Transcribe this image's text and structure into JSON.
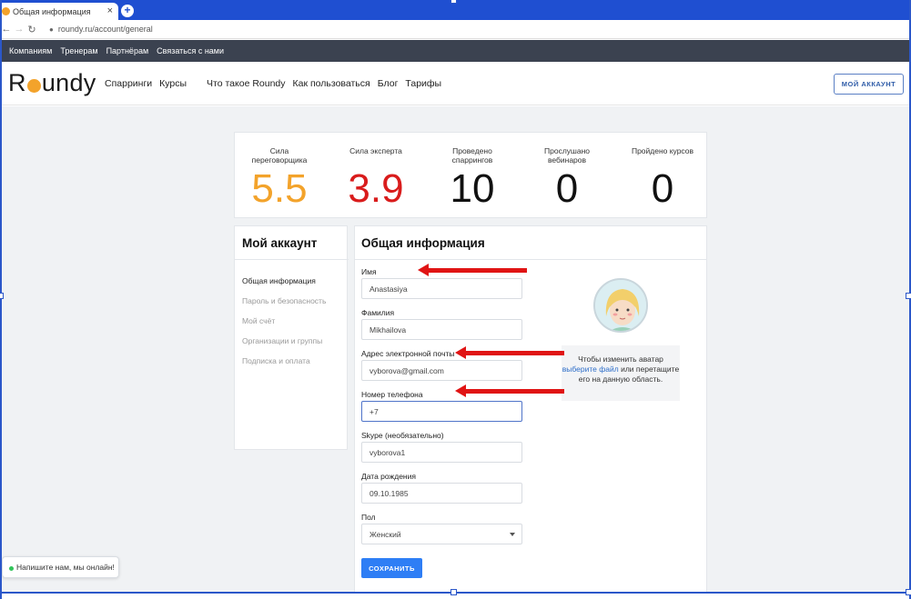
{
  "browser": {
    "tab_title": "Общая информация",
    "tab_close": "×",
    "new_tab": "+",
    "url": "roundy.ru/account/general",
    "back_icon": "arrow-left-icon",
    "forward_icon": "arrow-right-icon",
    "reload_icon": "reload-icon"
  },
  "topstrip": {
    "links": [
      "Компаниям",
      "Тренерам",
      "Партнёрам",
      "Связаться с нами"
    ]
  },
  "header": {
    "logo_before": "R",
    "logo_after": "undy",
    "nav": [
      "Спарринги",
      "Курсы",
      "Что такое Roundy",
      "Как пользоваться",
      "Блог",
      "Тарифы"
    ],
    "account_button": "МОЙ АККАУНТ"
  },
  "stats": [
    {
      "label": "Сила переговорщика",
      "value": "5.5",
      "color": "#f3a32b"
    },
    {
      "label": "Сила эксперта",
      "value": "3.9",
      "color": "#d91c1c"
    },
    {
      "label": "Проведено спаррингов",
      "value": "10",
      "color": "#111111"
    },
    {
      "label": "Прослушано вебинаров",
      "value": "0",
      "color": "#111111"
    },
    {
      "label": "Пройдено курсов",
      "value": "0",
      "color": "#111111"
    }
  ],
  "menu": {
    "title": "Мой аккаунт",
    "items": [
      "Общая информация",
      "Пароль и безопасность",
      "Мой счёт",
      "Организации и группы",
      "Подписка и оплата"
    ],
    "active_index": 0
  },
  "form": {
    "title": "Общая информация",
    "fields": {
      "first_name": {
        "label": "Имя",
        "value": "Anastasiya"
      },
      "last_name": {
        "label": "Фамилия",
        "value": "Mikhailova"
      },
      "email": {
        "label": "Адрес электронной почты",
        "value": "vyborova@gmail.com"
      },
      "phone": {
        "label": "Номер телефона",
        "value": "+7"
      },
      "skype": {
        "label": "Skype (необязательно)",
        "value": "vyborova1"
      },
      "birthdate": {
        "label": "Дата рождения",
        "value": "09.10.1985"
      },
      "gender": {
        "label": "Пол",
        "value": "Женский"
      }
    },
    "save_button": "СОХРАНИТЬ"
  },
  "avatar": {
    "hint_before": "Чтобы изменить аватар",
    "hint_link": "выберите файл",
    "hint_after": "или перетащите его на данную область."
  },
  "chat": {
    "label": "Напишите нам, мы онлайн!"
  },
  "colors": {
    "accent": "#2e7ef5",
    "arrow": "#e01414",
    "online": "#32c45a"
  }
}
